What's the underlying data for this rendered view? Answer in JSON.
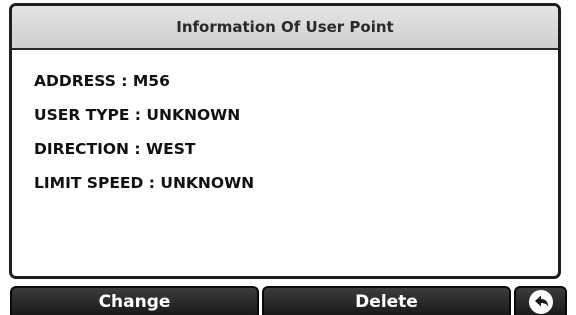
{
  "title": "Information Of User Point",
  "info_lines": [
    "ADDRESS : M56",
    "USER TYPE : UNKNOWN",
    "DIRECTION : WEST",
    "LIMIT SPEED : UNKNOWN"
  ],
  "buttons": {
    "change_label": "Change",
    "delete_label": "Delete",
    "back_icon": "back-arrow-icon"
  },
  "colors": {
    "frame": "#1e1e1e",
    "title_bg": "#d9d9d9",
    "button_bg": "#262626",
    "button_text": "#ffffff"
  }
}
